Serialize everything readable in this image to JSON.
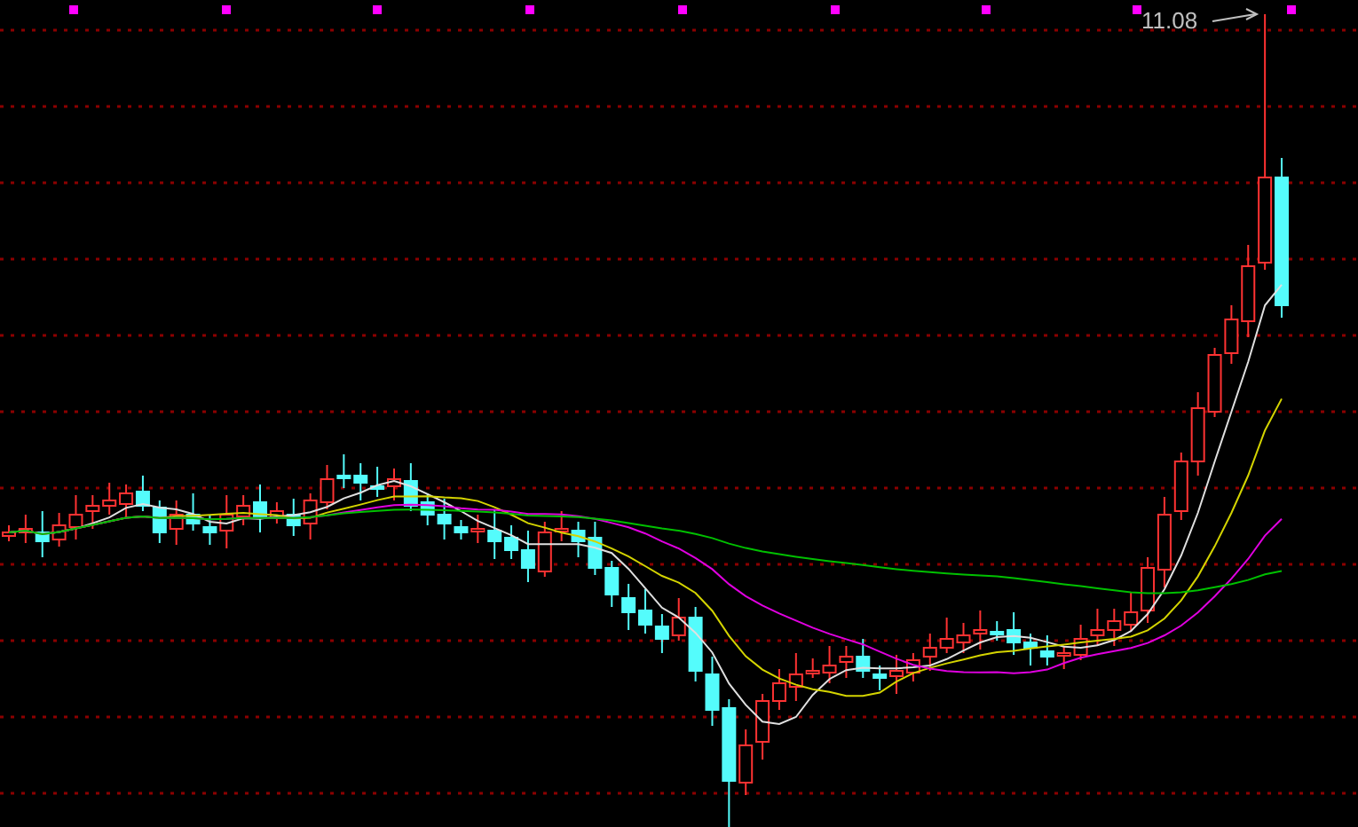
{
  "chart": {
    "high_label": "11.08"
  }
}
